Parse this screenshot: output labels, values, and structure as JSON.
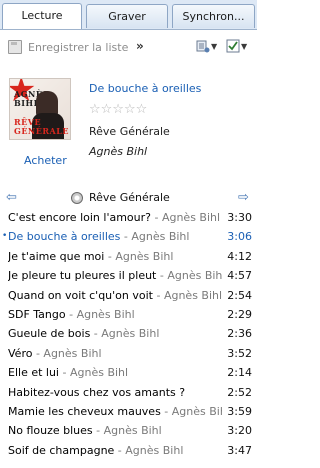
{
  "tabs": [
    {
      "label": "Lecture",
      "active": true
    },
    {
      "label": "Graver",
      "active": false
    },
    {
      "label": "Synchron...",
      "active": false
    }
  ],
  "toolbar": {
    "save_label": "Enregistrer la liste",
    "more_label": "»"
  },
  "now_playing": {
    "title": "De bouche à oreilles",
    "rating_stars": "☆☆☆☆☆",
    "album": "Rêve Générale",
    "artist": "Agnès Bihl",
    "buy_label": "Acheter",
    "cover_text_1": "AGNÈS",
    "cover_text_2": "BIHL",
    "cover_text_3": "RÊVE",
    "cover_text_4": "GÉNÉRALE"
  },
  "list_header": {
    "title": "Rêve Générale",
    "prev_icon": "arrow-left-icon",
    "next_icon": "arrow-right-icon"
  },
  "tracks": [
    {
      "title": "C'est encore loin l'amour?",
      "artist": "Agnès Bihl",
      "duration": "3:30",
      "playing": false
    },
    {
      "title": "De bouche à oreilles",
      "artist": "Agnès Bihl",
      "duration": "3:06",
      "playing": true
    },
    {
      "title": "Je t'aime que moi",
      "artist": "Agnès Bihl",
      "duration": "4:12",
      "playing": false
    },
    {
      "title": "Je pleure tu pleures il pleut",
      "artist": "Agnès Bihl",
      "duration": "4:57",
      "playing": false
    },
    {
      "title": "Quand on voit c'qu'on voit",
      "artist": "Agnès Bihl",
      "duration": "2:54",
      "playing": false
    },
    {
      "title": "SDF Tango",
      "artist": "Agnès Bihl",
      "duration": "2:29",
      "playing": false
    },
    {
      "title": "Gueule de bois",
      "artist": "Agnès Bihl",
      "duration": "2:36",
      "playing": false
    },
    {
      "title": "Véro",
      "artist": "Agnès Bihl",
      "duration": "3:52",
      "playing": false
    },
    {
      "title": "Elle et lui",
      "artist": "Agnès Bihl",
      "duration": "2:14",
      "playing": false
    },
    {
      "title": "Habitez-vous chez vos amants ?",
      "artist": "",
      "duration": "2:52",
      "playing": false
    },
    {
      "title": "Mamie les cheveux mauves",
      "artist": "Agnès Bihl",
      "duration": "3:59",
      "playing": false
    },
    {
      "title": "No flouze blues",
      "artist": "Agnès Bihl",
      "duration": "3:20",
      "playing": false
    },
    {
      "title": "Soif de champagne",
      "artist": "Agnès Bihl",
      "duration": "3:47",
      "playing": false
    }
  ],
  "colors": {
    "link": "#1a5fb4",
    "secondary_text": "#7a7a7a",
    "tab_bar": "#dde8f5"
  }
}
